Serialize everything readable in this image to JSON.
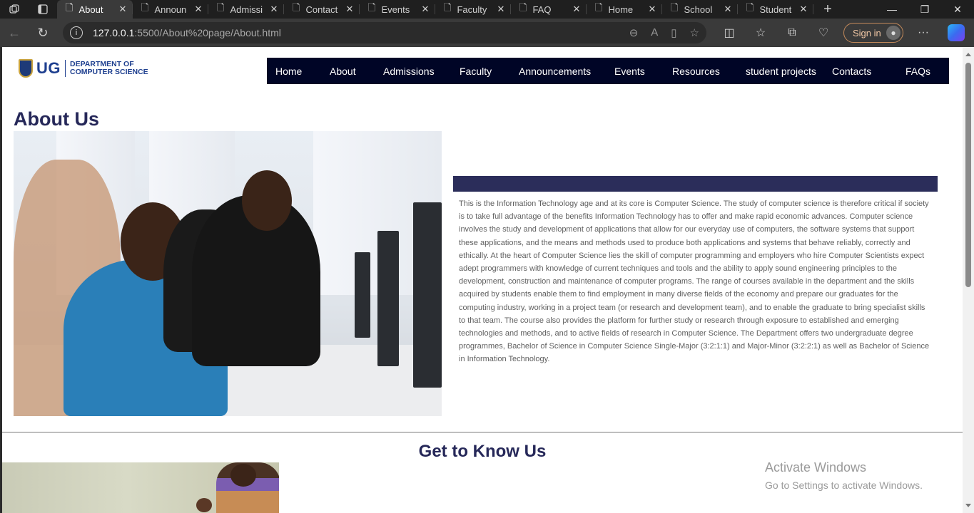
{
  "browser": {
    "tabs": [
      {
        "label": "About",
        "active": true
      },
      {
        "label": "Announ",
        "active": false
      },
      {
        "label": "Admissi",
        "active": false
      },
      {
        "label": "Contact",
        "active": false
      },
      {
        "label": "Events",
        "active": false
      },
      {
        "label": "Faculty",
        "active": false
      },
      {
        "label": "FAQ",
        "active": false
      },
      {
        "label": "Home",
        "active": false
      },
      {
        "label": "School",
        "active": false
      },
      {
        "label": "Student",
        "active": false
      }
    ],
    "url_host": "127.0.0.1",
    "url_path": ":5500/About%20page/About.html",
    "signin_label": "Sign in"
  },
  "site": {
    "logo_abbr": "UG",
    "logo_line1": "DEPARTMENT OF",
    "logo_line2": "COMPUTER SCIENCE",
    "nav": [
      "Home",
      "About",
      "Admissions",
      "Faculty",
      "Announcements",
      "Events",
      "Resources",
      "student projects",
      "Contacts",
      "FAQs"
    ]
  },
  "about": {
    "title": "About Us",
    "paragraph": "This is the Information Technology age and at its core is Computer Science. The study of computer science is therefore critical if society is to take full advantage of the benefits Information Technology has to offer and make rapid economic advances. Computer science involves the study and development of applications that allow for our everyday use of computers, the software systems that support these applications, and the means and methods used to produce both applications and systems that behave reliably, correctly and ethically. At the heart of Computer Science lies the skill of computer programming and employers who hire Computer Scientists expect adept programmers with knowledge of current techniques and tools and the ability to apply sound engineering principles to the development, construction and maintenance of computer programs. The range of courses available in the department and the skills acquired by students enable them to find employment in many diverse fields of the economy and prepare our graduates for the computing industry, working in a project team (or research and development team), and to enable the graduate to bring specialist skills to that team. The course also provides the platform for further study or research through exposure to established and emerging technologies and methods, and to active fields of research in Computer Science. The Department offers two undergraduate degree programmes, Bachelor of Science in Computer Science Single-Major (3:2:1:1) and Major-Minor (3:2:2:1) as well as Bachelor of Science in Information Technology."
  },
  "get_to_know": {
    "title": "Get to Know Us"
  },
  "watermark": {
    "line1": "Activate Windows",
    "line2": "Go to Settings to activate Windows."
  },
  "colors": {
    "navbar_bg": "#000526",
    "heading": "#262859",
    "accent_bar": "#2b2d5a"
  }
}
